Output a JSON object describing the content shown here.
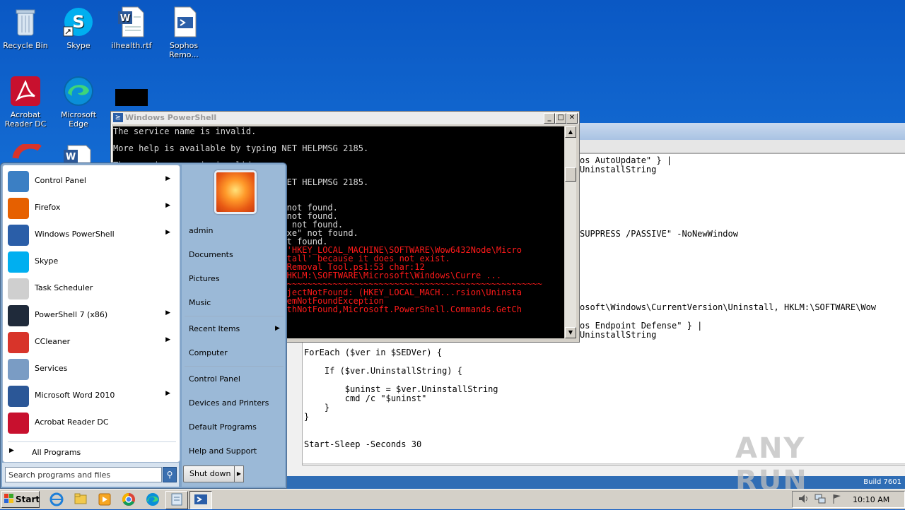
{
  "desktop_icons": [
    {
      "label": "Recycle Bin"
    },
    {
      "label": "Skype"
    },
    {
      "label": "ilhealth.rtf"
    },
    {
      "label": "Sophos Remo..."
    },
    {
      "label": "Acrobat Reader DC"
    },
    {
      "label": "Microsoft Edge"
    }
  ],
  "powershell": {
    "title": "Windows PowerShell",
    "lines": [
      {
        "text": "The service name is invalid.",
        "color": "white"
      },
      {
        "text": "",
        "color": "white"
      },
      {
        "text": "More help is available by typing NET HELPMSG 2185.",
        "color": "white"
      },
      {
        "text": "",
        "color": "white"
      },
      {
        "text": "The service name is invalid.",
        "color": "white"
      },
      {
        "text": "",
        "color": "white"
      },
      {
        "text": "More help is available by typing NET HELPMSG 2185.",
        "color": "white"
      },
      {
        "text": "",
        "color": "white"
      },
      {
        "text": "",
        "color": "white"
      },
      {
        "text": "                                  not found.",
        "color": "white"
      },
      {
        "text": "                                  not found.",
        "color": "white"
      },
      {
        "text": "                                 ' not found.",
        "color": "white"
      },
      {
        "text": "                                 exe\" not found.",
        "color": "white"
      },
      {
        "text": "                                 ot found.",
        "color": "white"
      },
      {
        "text": "                                h 'HKEY_LOCAL_MACHINE\\SOFTWARE\\Wow6432Node\\Micro",
        "color": "red"
      },
      {
        "text": "                                nstall' because it does not exist.",
        "color": "red"
      },
      {
        "text": "                                s Removal Tool.ps1:53 char:12",
        "color": "red"
      },
      {
        "text": "                                h HKLM:\\SOFTWARE\\Microsoft\\Windows\\Curre ...",
        "color": "red"
      },
      {
        "text": "                                ~~~~~~~~~~~~~~~~~~~~~~~~~~~~~~~~~~~~~~~~~~~~~~~~~~~~",
        "color": "red"
      },
      {
        "text": "                                 bjectNotFound: (HKEY_LOCAL_MACH...rsion\\Uninsta",
        "color": "red"
      },
      {
        "text": "                                 temNotFoundException",
        "color": "red"
      },
      {
        "text": "                                 athNotFound,Microsoft.PowerShell.Commands.GetCh",
        "color": "red"
      }
    ]
  },
  "ise": {
    "code_lines": [
      {
        "text": "os AutoUpdate\" } |",
        "row": 0
      },
      {
        "text": "UninstallString",
        "row": 1
      },
      {
        "text": "SUPPRESS /PASSIVE\" -NoNewWindow",
        "row": 8
      },
      {
        "text": "osoft\\Windows\\CurrentVersion\\Uninstall, HKLM:\\SOFTWARE\\Wow",
        "row": 16
      },
      {
        "text": "os Endpoint Defense\" } |",
        "row": 18
      },
      {
        "text": "UninstallString",
        "row": 19
      }
    ],
    "lower_code": [
      "ForEach ($ver in $SEDVer) {",
      "",
      "    If ($ver.UninstallString) {",
      "",
      "        $uninst = $ver.UninstallString",
      "        cmd /c \"$uninst\"",
      "    }",
      "}",
      "",
      "",
      "Start-Sleep -Seconds 30"
    ]
  },
  "start_menu": {
    "programs": [
      {
        "label": "Control Panel",
        "has_arrow": true,
        "icon": "control-panel-icon",
        "color": "#3b7fc4"
      },
      {
        "label": "Firefox",
        "has_arrow": true,
        "icon": "firefox-icon",
        "color": "#e66000"
      },
      {
        "label": "Windows PowerShell",
        "has_arrow": true,
        "icon": "powershell-icon",
        "color": "#2a5ea8"
      },
      {
        "label": "Skype",
        "has_arrow": false,
        "icon": "skype-icon",
        "color": "#00aff0"
      },
      {
        "label": "Task Scheduler",
        "has_arrow": false,
        "icon": "task-scheduler-icon",
        "color": "#cfcfcf"
      },
      {
        "label": "PowerShell 7 (x86)",
        "has_arrow": true,
        "icon": "powershell7-icon",
        "color": "#1f2a3a"
      },
      {
        "label": "CCleaner",
        "has_arrow": true,
        "icon": "ccleaner-icon",
        "color": "#d8342a"
      },
      {
        "label": "Services",
        "has_arrow": false,
        "icon": "services-icon",
        "color": "#7a9cc4"
      },
      {
        "label": "Microsoft Word 2010",
        "has_arrow": true,
        "icon": "word-icon",
        "color": "#2b5797"
      },
      {
        "label": "Acrobat Reader DC",
        "has_arrow": false,
        "icon": "acrobat-icon",
        "color": "#c8102e"
      }
    ],
    "all_programs": "All Programs",
    "search_placeholder": "Search programs and files",
    "right_items": [
      "admin",
      "Documents",
      "Pictures",
      "Music",
      "Recent Items",
      "Computer",
      "Control Panel",
      "Devices and Printers",
      "Default Programs",
      "Help and Support"
    ],
    "shutdown_label": "Shut down"
  },
  "taskbar": {
    "start_label": "Start",
    "clock": "10:10 AM",
    "build": "Build 7601"
  },
  "watermark": "ANY RUN"
}
